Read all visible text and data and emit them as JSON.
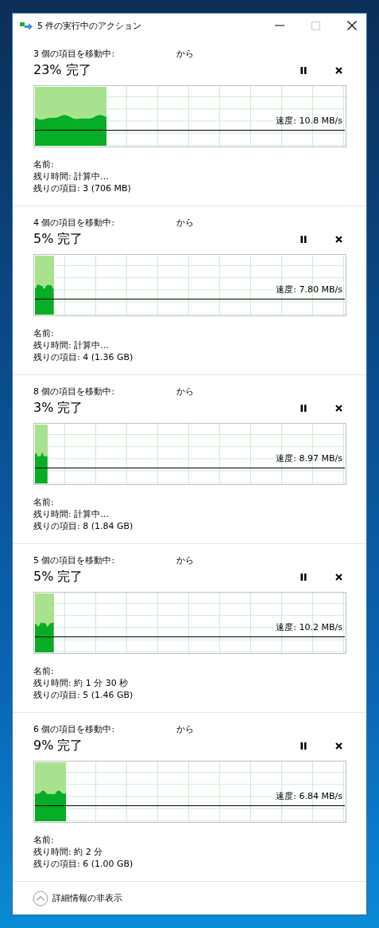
{
  "window": {
    "title": "5 件の実行中のアクション"
  },
  "operations": [
    {
      "heading": "3 個の項目を移動中:",
      "source": "から",
      "percent": "23% 完了",
      "level": 0.23,
      "speed": "速度: 10.8 MB/s",
      "name": "名前:",
      "time_left": "残り時間: 計算中...",
      "items_left": "残りの項目: 3 (706 MB)"
    },
    {
      "heading": "4 個の項目を移動中:",
      "source": "から",
      "percent": "5% 完了",
      "level": 0.06,
      "speed": "速度: 7.80 MB/s",
      "name": "名前:",
      "time_left": "残り時間: 計算中...",
      "items_left": "残りの項目: 4 (1.36 GB)"
    },
    {
      "heading": "8 個の項目を移動中:",
      "source": "から",
      "percent": "3% 完了",
      "level": 0.04,
      "speed": "速度: 8.97 MB/s",
      "name": "名前:",
      "time_left": "残り時間: 計算中...",
      "items_left": "残りの項目: 8 (1.84 GB)"
    },
    {
      "heading": "5 個の項目を移動中:",
      "source": "から",
      "percent": "5% 完了",
      "level": 0.06,
      "speed": "速度: 10.2 MB/s",
      "name": "名前:",
      "time_left": "残り時間: 約 1 分 30 秒",
      "items_left": "残りの項目: 5 (1.46 GB)"
    },
    {
      "heading": "6 個の項目を移動中:",
      "source": "から",
      "percent": "9% 完了",
      "level": 0.1,
      "speed": "速度: 6.84 MB/s",
      "name": "名前:",
      "time_left": "残り時間: 約 2 分",
      "items_left": "残りの項目: 6 (1.00 GB)"
    }
  ],
  "footer": {
    "label": "詳細情報の非表示"
  }
}
